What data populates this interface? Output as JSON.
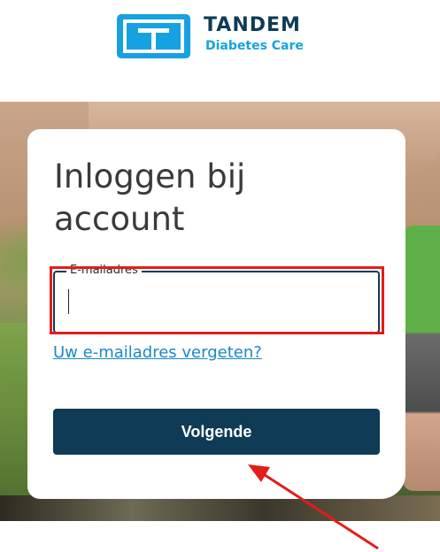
{
  "brand": {
    "name": "TANDEM",
    "tagline": "Diabetes Care",
    "logo_icon": "tandem-t-logo",
    "accent_color": "#16a2e0",
    "dark_color": "#0f3b57"
  },
  "login": {
    "title_line1": "Inloggen bij",
    "title_line2": "account",
    "email_label": "E-mailadres",
    "email_value": "",
    "forgot_link": "Uw e-mailadres vergeten?",
    "next_button": "Volgende"
  },
  "annotations": {
    "highlight_color": "#e31c1c",
    "arrow_color": "#e31c1c"
  }
}
